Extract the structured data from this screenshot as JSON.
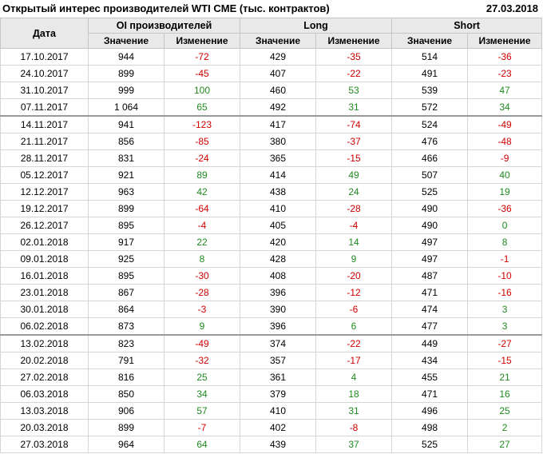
{
  "header": {
    "title": "Открытый интерес производителей WTI CME (тыс. контрактов)",
    "date": "27.03.2018"
  },
  "columns": {
    "date": "Дата",
    "groups": [
      "OI производителей",
      "Long",
      "Short"
    ],
    "value": "Значение",
    "change": "Изменение"
  },
  "colors": {
    "negative": "#d00000",
    "positive": "#208a20",
    "header_bg": "#e9e9e9"
  },
  "rows": [
    {
      "date": "17.10.2017",
      "oi": "944",
      "oi_chg": "-72",
      "long": "429",
      "long_chg": "-35",
      "short": "514",
      "short_chg": "-36"
    },
    {
      "date": "24.10.2017",
      "oi": "899",
      "oi_chg": "-45",
      "long": "407",
      "long_chg": "-22",
      "short": "491",
      "short_chg": "-23"
    },
    {
      "date": "31.10.2017",
      "oi": "999",
      "oi_chg": "100",
      "long": "460",
      "long_chg": "53",
      "short": "539",
      "short_chg": "47"
    },
    {
      "date": "07.11.2017",
      "oi": "1 064",
      "oi_chg": "65",
      "long": "492",
      "long_chg": "31",
      "short": "572",
      "short_chg": "34"
    },
    {
      "date": "14.11.2017",
      "oi": "941",
      "oi_chg": "-123",
      "long": "417",
      "long_chg": "-74",
      "short": "524",
      "short_chg": "-49"
    },
    {
      "date": "21.11.2017",
      "oi": "856",
      "oi_chg": "-85",
      "long": "380",
      "long_chg": "-37",
      "short": "476",
      "short_chg": "-48"
    },
    {
      "date": "28.11.2017",
      "oi": "831",
      "oi_chg": "-24",
      "long": "365",
      "long_chg": "-15",
      "short": "466",
      "short_chg": "-9"
    },
    {
      "date": "05.12.2017",
      "oi": "921",
      "oi_chg": "89",
      "long": "414",
      "long_chg": "49",
      "short": "507",
      "short_chg": "40"
    },
    {
      "date": "12.12.2017",
      "oi": "963",
      "oi_chg": "42",
      "long": "438",
      "long_chg": "24",
      "short": "525",
      "short_chg": "19"
    },
    {
      "date": "19.12.2017",
      "oi": "899",
      "oi_chg": "-64",
      "long": "410",
      "long_chg": "-28",
      "short": "490",
      "short_chg": "-36"
    },
    {
      "date": "26.12.2017",
      "oi": "895",
      "oi_chg": "-4",
      "long": "405",
      "long_chg": "-4",
      "short": "490",
      "short_chg": "0"
    },
    {
      "date": "02.01.2018",
      "oi": "917",
      "oi_chg": "22",
      "long": "420",
      "long_chg": "14",
      "short": "497",
      "short_chg": "8"
    },
    {
      "date": "09.01.2018",
      "oi": "925",
      "oi_chg": "8",
      "long": "428",
      "long_chg": "9",
      "short": "497",
      "short_chg": "-1"
    },
    {
      "date": "16.01.2018",
      "oi": "895",
      "oi_chg": "-30",
      "long": "408",
      "long_chg": "-20",
      "short": "487",
      "short_chg": "-10"
    },
    {
      "date": "23.01.2018",
      "oi": "867",
      "oi_chg": "-28",
      "long": "396",
      "long_chg": "-12",
      "short": "471",
      "short_chg": "-16"
    },
    {
      "date": "30.01.2018",
      "oi": "864",
      "oi_chg": "-3",
      "long": "390",
      "long_chg": "-6",
      "short": "474",
      "short_chg": "3"
    },
    {
      "date": "06.02.2018",
      "oi": "873",
      "oi_chg": "9",
      "long": "396",
      "long_chg": "6",
      "short": "477",
      "short_chg": "3"
    },
    {
      "date": "13.02.2018",
      "oi": "823",
      "oi_chg": "-49",
      "long": "374",
      "long_chg": "-22",
      "short": "449",
      "short_chg": "-27"
    },
    {
      "date": "20.02.2018",
      "oi": "791",
      "oi_chg": "-32",
      "long": "357",
      "long_chg": "-17",
      "short": "434",
      "short_chg": "-15"
    },
    {
      "date": "27.02.2018",
      "oi": "816",
      "oi_chg": "25",
      "long": "361",
      "long_chg": "4",
      "short": "455",
      "short_chg": "21"
    },
    {
      "date": "06.03.2018",
      "oi": "850",
      "oi_chg": "34",
      "long": "379",
      "long_chg": "18",
      "short": "471",
      "short_chg": "16"
    },
    {
      "date": "13.03.2018",
      "oi": "906",
      "oi_chg": "57",
      "long": "410",
      "long_chg": "31",
      "short": "496",
      "short_chg": "25"
    },
    {
      "date": "20.03.2018",
      "oi": "899",
      "oi_chg": "-7",
      "long": "402",
      "long_chg": "-8",
      "short": "498",
      "short_chg": "2"
    },
    {
      "date": "27.03.2018",
      "oi": "964",
      "oi_chg": "64",
      "long": "439",
      "long_chg": "37",
      "short": "525",
      "short_chg": "27"
    }
  ]
}
